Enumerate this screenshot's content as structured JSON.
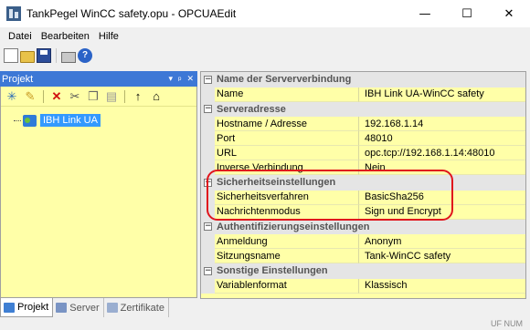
{
  "window": {
    "title": "TankPegel WinCC safety.opu - OPCUAEdit",
    "minimize": "—",
    "maximize": "☐",
    "close": "✕"
  },
  "menu": [
    "Datei",
    "Bearbeiten",
    "Hilfe"
  ],
  "toolbar": {
    "help_glyph": "?"
  },
  "left_pane": {
    "title": "Projekt",
    "ctrl_dropdown": "▾",
    "ctrl_pin": "ᵖ",
    "ctrl_close": "✕",
    "tree_root": "IBH Link UA",
    "tabs": [
      "Projekt",
      "Server",
      "Zertifikate"
    ]
  },
  "grid": {
    "categories": [
      {
        "label": "Name der Serververbindung",
        "props": [
          {
            "name": "Name",
            "value": "IBH Link UA-WinCC safety"
          }
        ]
      },
      {
        "label": "Serveradresse",
        "props": [
          {
            "name": "Hostname / Adresse",
            "value": "192.168.1.14"
          },
          {
            "name": "Port",
            "value": "48010"
          },
          {
            "name": "URL",
            "value": "opc.tcp://192.168.1.14:48010"
          },
          {
            "name": "Inverse Verbindung",
            "value": "Nein"
          }
        ]
      },
      {
        "label": "Sicherheitseinstellungen",
        "props": [
          {
            "name": "Sicherheitsverfahren",
            "value": "BasicSha256"
          },
          {
            "name": "Nachrichtenmodus",
            "value": "Sign und Encrypt"
          }
        ]
      },
      {
        "label": "Authentifizierungseinstellungen",
        "props": [
          {
            "name": "Anmeldung",
            "value": "Anonym"
          },
          {
            "name": "Sitzungsname",
            "value": "Tank-WinCC safety"
          }
        ]
      },
      {
        "label": "Sonstige Einstellungen",
        "props": [
          {
            "name": "Variablenformat",
            "value": "Klassisch"
          }
        ]
      }
    ],
    "toggle_glyph": "−",
    "highlight_color": "#e0141c"
  },
  "status": {
    "text": "UF NUM"
  },
  "colors": {
    "pane_header": "#3d78d6",
    "pane_background": "#ffffa8",
    "selection": "#3399ff"
  }
}
